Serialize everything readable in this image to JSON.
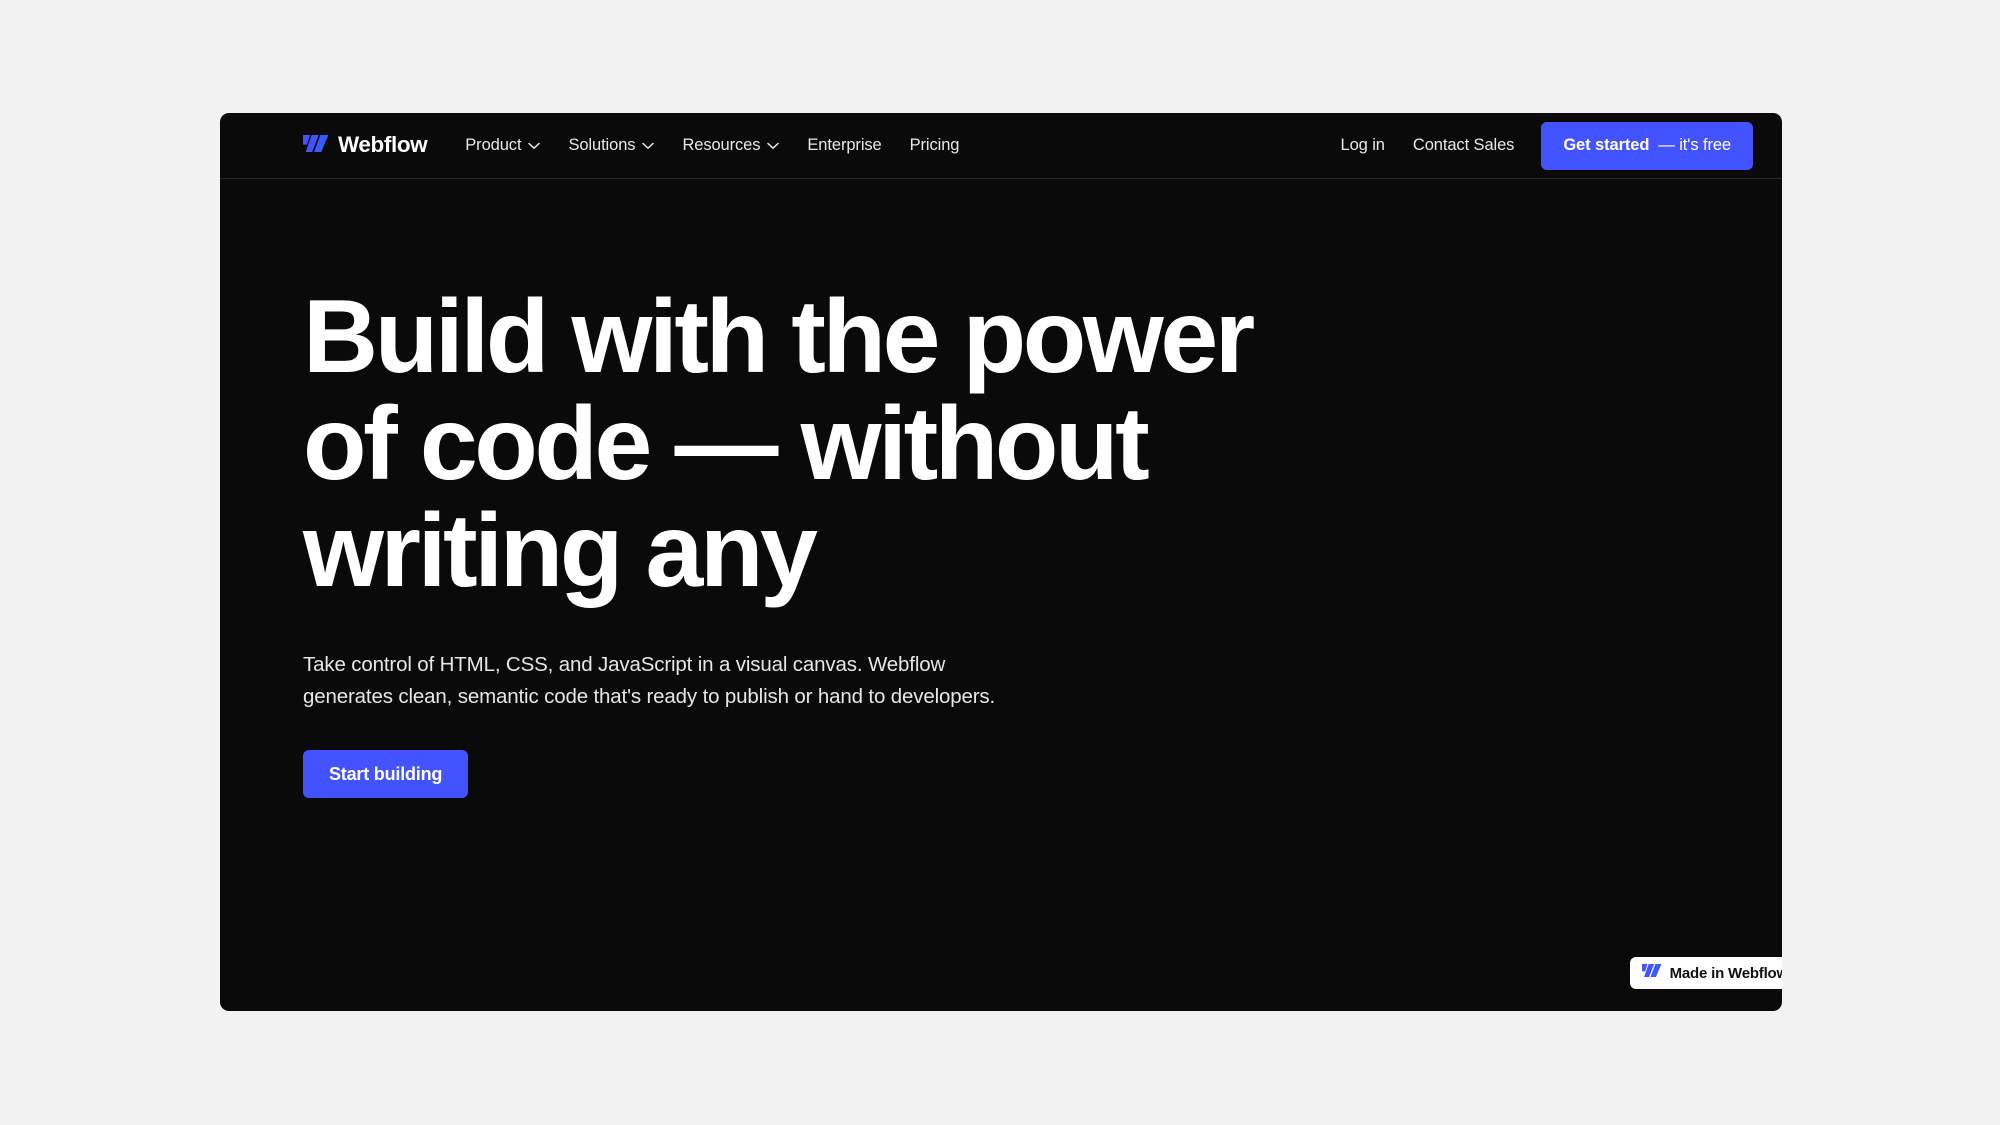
{
  "theme": {
    "page_background": "#f2f2f2",
    "panel_background": "#0a0a0a",
    "accent_blue": "#4353ff",
    "text_primary": "#ffffff",
    "nav_divider": "#262626"
  },
  "nav": {
    "brand": {
      "name": "Webflow",
      "logo_icon": "webflow-logo-icon"
    },
    "links": [
      {
        "label": "Product",
        "has_dropdown": true,
        "icon": "chevron-down-icon"
      },
      {
        "label": "Solutions",
        "has_dropdown": true,
        "icon": "chevron-down-icon"
      },
      {
        "label": "Resources",
        "has_dropdown": true,
        "icon": "chevron-down-icon"
      },
      {
        "label": "Enterprise",
        "has_dropdown": false,
        "icon": ""
      },
      {
        "label": "Pricing",
        "has_dropdown": false,
        "icon": ""
      }
    ],
    "actions": [
      {
        "label": "Log in"
      },
      {
        "label": "Contact Sales"
      }
    ],
    "cta": {
      "label_strong": "Get started",
      "label_sub": "— it's free"
    }
  },
  "hero": {
    "headline_lines": [
      "Build with the power",
      "of code — without",
      "writing any"
    ],
    "subtext_lines": [
      "Take control of HTML, CSS, and JavaScript in a visual canvas. Webflow",
      "generates clean, semantic code that's ready to publish or hand to developers."
    ],
    "cta_label": "Start building"
  },
  "badge": {
    "label": "Made in Webflow",
    "logo_icon": "webflow-logo-icon"
  }
}
